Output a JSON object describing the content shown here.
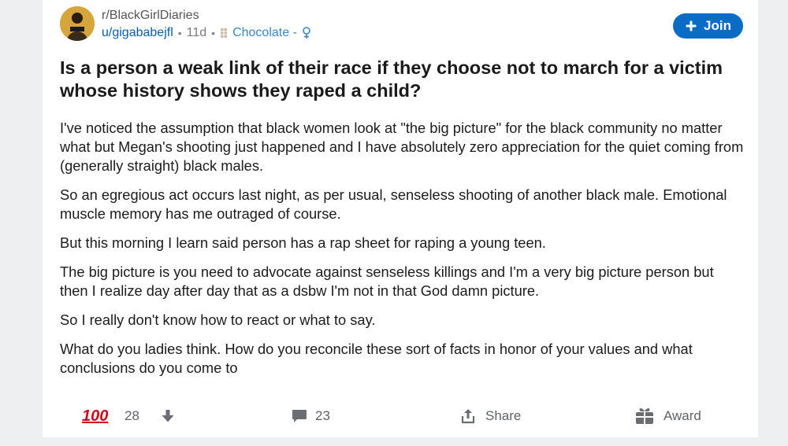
{
  "post": {
    "subreddit": "r/BlackGirlDiaries",
    "username": "u/gigababejfl",
    "age": "11d",
    "flair": "Chocolate -",
    "title": "Is a person a weak link of their race if they choose not to march for a victim whose history shows they raped a child?",
    "paragraphs": [
      "I've noticed the assumption that black women look at \"the big picture\" for the black community no matter what but Megan's shooting just happened and I have absolutely zero appreciation for the quiet coming from (generally straight) black males.",
      "So an egregious act occurs last night, as per usual, senseless shooting of another black male. Emotional muscle memory has me outraged of course.",
      "But this morning I learn said person has a rap sheet for raping a young teen.",
      "The big picture is you need to advocate against senseless killings and I'm a very big picture person but then I realize day after day that as a dsbw I'm not in that God damn picture.",
      "So I really don't know how to react or what to say.",
      "What do you ladies think. How do you reconcile these sort of facts in honor of your values and what conclusions do you come to"
    ]
  },
  "header": {
    "join_label": "Join"
  },
  "actions": {
    "award_glyph": "100",
    "score": "28",
    "comments": "23",
    "share_label": "Share",
    "award_label": "Award"
  },
  "colors": {
    "accent": "#0a6cc4",
    "username": "#0a5ea8",
    "flair": "#3a86c8"
  },
  "icons": [
    "avatar",
    "plus-icon",
    "chocolate-flair-icon",
    "female-sign-icon",
    "hundred-points-icon",
    "downvote-icon",
    "comment-icon",
    "share-icon",
    "award-icon"
  ]
}
